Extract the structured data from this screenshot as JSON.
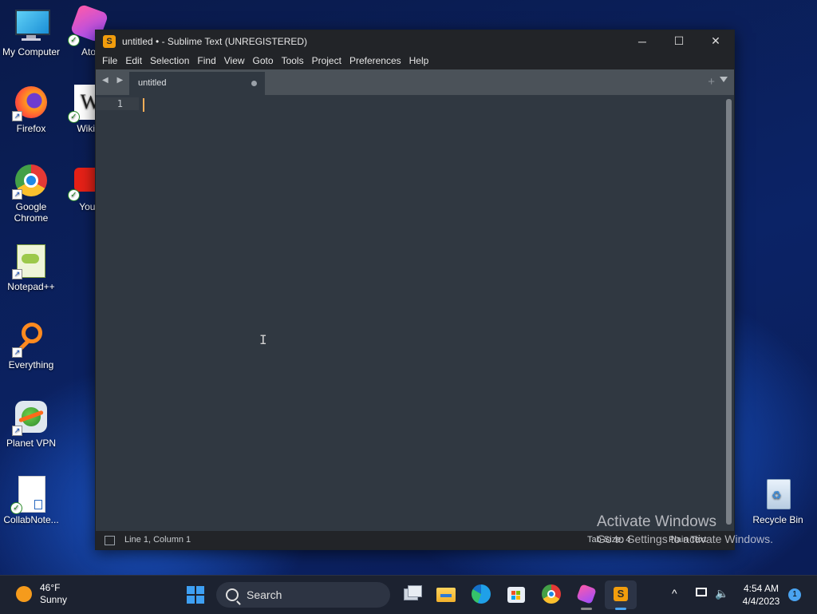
{
  "desktop": {
    "icons": [
      {
        "label": "My Computer"
      },
      {
        "label": "Firefox"
      },
      {
        "label": "Google Chrome"
      },
      {
        "label": "Notepad++"
      },
      {
        "label": "Everything"
      },
      {
        "label": "Planet VPN"
      },
      {
        "label": "CollabNote..."
      },
      {
        "label": "Ato"
      },
      {
        "label": "Wikip"
      },
      {
        "label": "Yout"
      },
      {
        "label": "Recycle Bin"
      }
    ]
  },
  "window": {
    "title": "untitled • - Sublime Text (UNREGISTERED)",
    "controls": {
      "minimize": "─",
      "maximize": "☐",
      "close": "✕"
    },
    "menu": [
      "File",
      "Edit",
      "Selection",
      "Find",
      "View",
      "Goto",
      "Tools",
      "Project",
      "Preferences",
      "Help"
    ],
    "tab": {
      "label": "untitled"
    },
    "tab_arrows": "◀ ▶",
    "tab_plus": "+",
    "editor": {
      "line_number": "1"
    },
    "status": {
      "position": "Line 1, Column 1",
      "tab_size": "Tab Size: 4",
      "syntax": "Plain Text"
    }
  },
  "watermark": {
    "line1": "Activate Windows",
    "line2": "Go to Settings to activate Windows."
  },
  "taskbar": {
    "weather": {
      "temp": "46°F",
      "condition": "Sunny"
    },
    "search_label": "Search",
    "clock": {
      "time": "4:54 AM",
      "date": "4/4/2023"
    },
    "notification_count": "1",
    "tray_chevron": "^"
  },
  "colors": {
    "accent": "#f29d0c",
    "editor_bg": "#303841",
    "caret": "#f9ae58"
  }
}
